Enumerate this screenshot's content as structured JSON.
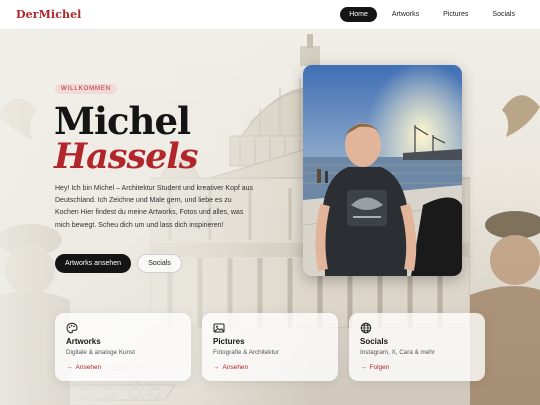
{
  "nav": {
    "brand": "DerMichel",
    "links": [
      {
        "label": "Home",
        "active": true
      },
      {
        "label": "Artworks",
        "active": false
      },
      {
        "label": "Pictures",
        "active": false
      },
      {
        "label": "Socials",
        "active": false
      }
    ]
  },
  "hero": {
    "badge": "WILLKOMMEN",
    "first_name": "Michel",
    "last_name": "Hassels",
    "intro": "Hey! Ich bin Michel – Architektur Student und kreativer Kopf aus Deutschland. Ich Zeichne und Male gern, und liebe es zu Kochen Hier findest du meine Artworks, Fotos und alles, was mich bewegt. Scheu dich um und lass dich inspirieren!",
    "primary_button": "Artworks ansehen",
    "secondary_button": "Socials"
  },
  "cards": [
    {
      "icon": "palette-icon",
      "title": "Artworks",
      "subtitle": "Digitale & analoge Kunst",
      "link": "Ansehen"
    },
    {
      "icon": "image-icon",
      "title": "Pictures",
      "subtitle": "Fotografie & Architektur",
      "link": "Ansehen"
    },
    {
      "icon": "globe-icon",
      "title": "Socials",
      "subtitle": "Instagram, X, Cara & mehr",
      "link": "Folgen"
    }
  ],
  "colors": {
    "accent": "#b2262b",
    "dark": "#141414",
    "background": "#e9e6df"
  }
}
